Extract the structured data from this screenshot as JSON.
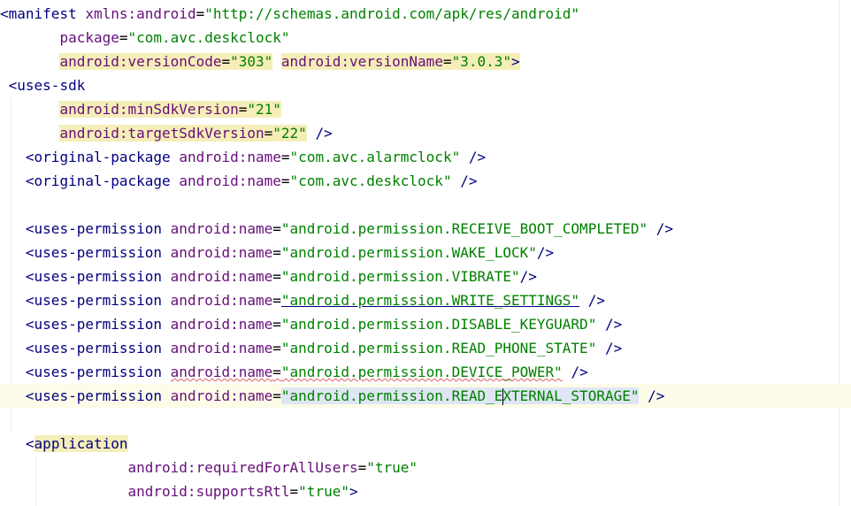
{
  "editor": {
    "manifest_open": "<manifest",
    "xmlns_attr": "xmlns:android",
    "xmlns_value": "\"http://schemas.android.com/apk/res/android\"",
    "package_attr": "package",
    "package_value": "\"com.avc.deskclock\"",
    "version_code_attr": "android:versionCode",
    "version_code_value": "\"303\"",
    "version_name_attr": "android:versionName",
    "version_name_value": "\"3.0.3\"",
    "uses_sdk_open": "<uses-sdk",
    "min_sdk_attr": "android:minSdkVersion",
    "min_sdk_value": "\"21\"",
    "target_sdk_attr": "android:targetSdkVersion",
    "target_sdk_value": "\"22\"",
    "self_close": "/>",
    "close_bracket": ">",
    "original_package_tag": "<original-package",
    "name_attr": "android:name",
    "original_packages": [
      "\"com.avc.alarmclock\"",
      "\"com.avc.deskclock\""
    ],
    "uses_permission_tag": "<uses-permission",
    "permissions": [
      "\"android.permission.RECEIVE_BOOT_COMPLETED\"",
      "\"android.permission.WAKE_LOCK\"",
      "\"android.permission.VIBRATE\"",
      "\"android.permission.WRITE_SETTINGS\"",
      "\"android.permission.DISABLE_KEYGUARD\"",
      "\"android.permission.READ_PHONE_STATE\"",
      "\"android.permission.DEVICE_POWER\""
    ],
    "current_permission_before_caret": "\"android.permission.READ_E",
    "current_permission_after_caret": "XTERNAL_STORAGE\"",
    "application_lt": "<",
    "application_tag": "application",
    "required_users_attr": "android:requiredForAllUsers",
    "required_users_value": "\"true\"",
    "supports_rtl_attr": "android:supportsRtl",
    "supports_rtl_value": "\"true\""
  },
  "colors": {
    "tag": "#000080",
    "attribute": "#660e7a",
    "value": "#008000",
    "current_line": "#fdfce8",
    "highlight": "#f5eeb8",
    "selection": "#dfe6f3"
  }
}
